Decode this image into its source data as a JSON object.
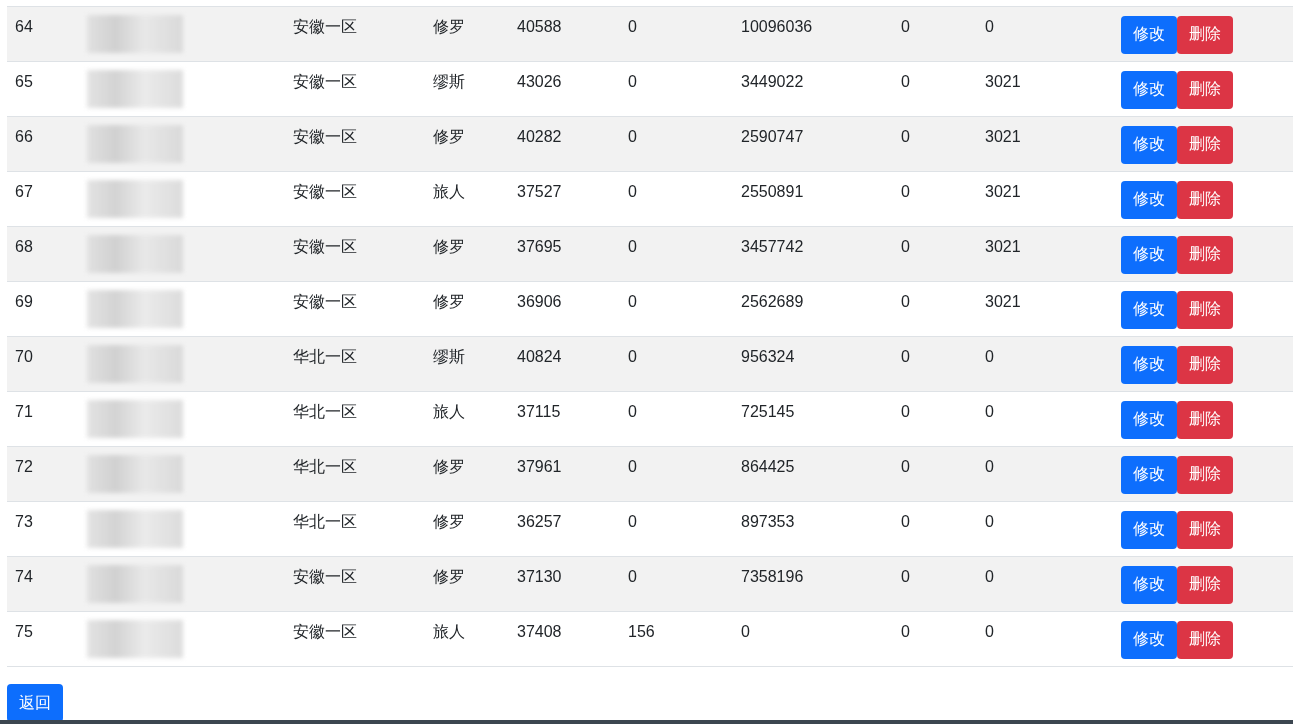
{
  "rows": [
    {
      "cells": [
        "64",
        "安徽一区",
        "修罗",
        "40588",
        "0",
        "10096036",
        "0",
        "0"
      ],
      "actions": [
        "修改",
        "删除"
      ]
    },
    {
      "cells": [
        "65",
        "安徽一区",
        "缪斯",
        "43026",
        "0",
        "3449022",
        "0",
        "3021"
      ],
      "actions": [
        "修改",
        "删除"
      ]
    },
    {
      "cells": [
        "66",
        "安徽一区",
        "修罗",
        "40282",
        "0",
        "2590747",
        "0",
        "3021"
      ],
      "actions": [
        "修改",
        "删除"
      ]
    },
    {
      "cells": [
        "67",
        "安徽一区",
        "旅人",
        "37527",
        "0",
        "2550891",
        "0",
        "3021"
      ],
      "actions": [
        "修改",
        "删除"
      ]
    },
    {
      "cells": [
        "68",
        "安徽一区",
        "修罗",
        "37695",
        "0",
        "3457742",
        "0",
        "3021"
      ],
      "actions": [
        "修改",
        "删除"
      ]
    },
    {
      "cells": [
        "69",
        "安徽一区",
        "修罗",
        "36906",
        "0",
        "2562689",
        "0",
        "3021"
      ],
      "actions": [
        "修改",
        "删除"
      ]
    },
    {
      "cells": [
        "70",
        "华北一区",
        "缪斯",
        "40824",
        "0",
        "956324",
        "0",
        "0"
      ],
      "actions": [
        "修改",
        "删除"
      ]
    },
    {
      "cells": [
        "71",
        "华北一区",
        "旅人",
        "37115",
        "0",
        "725145",
        "0",
        "0"
      ],
      "actions": [
        "修改",
        "删除"
      ]
    },
    {
      "cells": [
        "72",
        "华北一区",
        "修罗",
        "37961",
        "0",
        "864425",
        "0",
        "0"
      ],
      "actions": [
        "修改",
        "删除"
      ]
    },
    {
      "cells": [
        "73",
        "华北一区",
        "修罗",
        "36257",
        "0",
        "897353",
        "0",
        "0"
      ],
      "actions": [
        "修改",
        "删除"
      ]
    },
    {
      "cells": [
        "74",
        "安徽一区",
        "修罗",
        "37130",
        "0",
        "7358196",
        "0",
        "0"
      ],
      "actions": [
        "修改",
        "删除"
      ]
    },
    {
      "cells": [
        "75",
        "安徽一区",
        "旅人",
        "37408",
        "156",
        "0",
        "0",
        "0"
      ],
      "actions": [
        "修改",
        "删除"
      ]
    }
  ],
  "back_button": "返回"
}
